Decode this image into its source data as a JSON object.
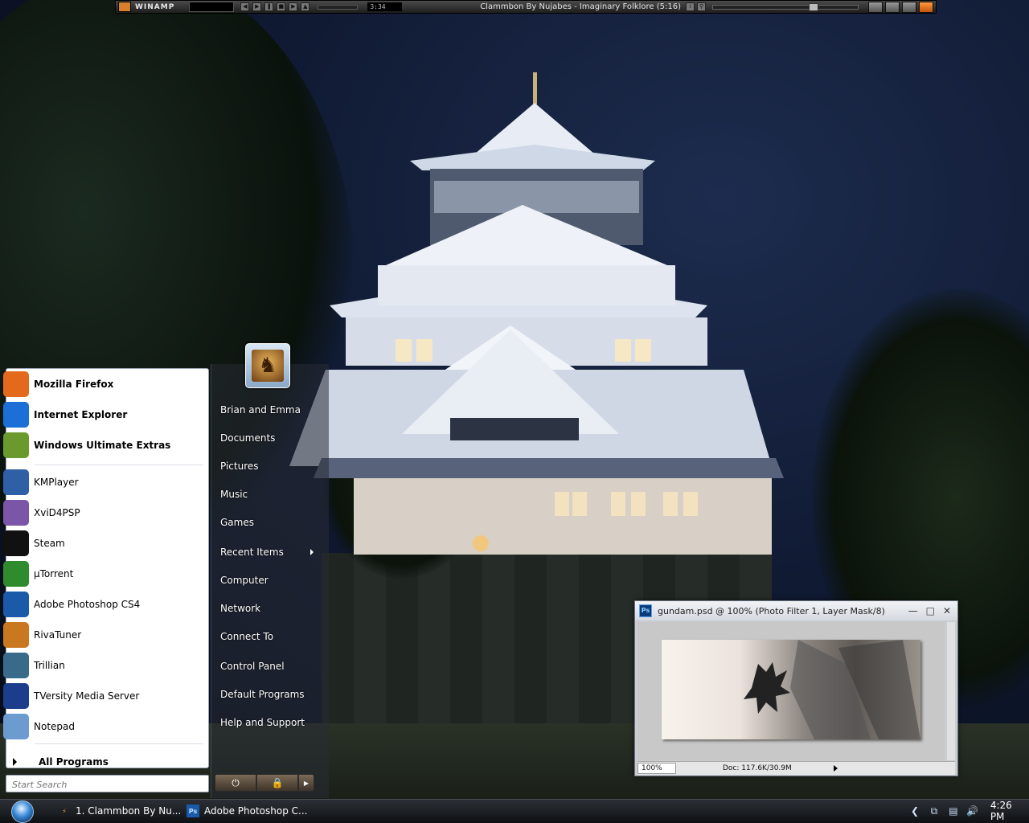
{
  "winamp": {
    "title": "WINAMP",
    "time": "3:34",
    "now_playing": "Clammbon By Nujabes - Imaginary Folklore (5:16)",
    "seek_fraction": 0.7
  },
  "start_menu": {
    "user_name": "Brian and Emma",
    "pinned": [
      {
        "label": "Mozilla Firefox",
        "icon": "firefox-icon",
        "color": "#e36a1c"
      },
      {
        "label": "Internet Explorer",
        "icon": "internet-explorer-icon",
        "color": "#1b6fd6"
      },
      {
        "label": "Windows Ultimate Extras",
        "icon": "ultimate-extras-icon",
        "color": "#6a9a2e"
      }
    ],
    "recent": [
      {
        "label": "KMPlayer",
        "icon": "kmplayer-icon",
        "color": "#2f5fa5"
      },
      {
        "label": "XviD4PSP",
        "icon": "xvid4psp-icon",
        "color": "#7a55a8"
      },
      {
        "label": "Steam",
        "icon": "steam-icon",
        "color": "#111111"
      },
      {
        "label": "µTorrent",
        "icon": "utorrent-icon",
        "color": "#2e8b2e"
      },
      {
        "label": "Adobe Photoshop CS4",
        "icon": "photoshop-icon",
        "color": "#1a5aa8"
      },
      {
        "label": "RivaTuner",
        "icon": "rivatuner-icon",
        "color": "#c9781f"
      },
      {
        "label": "Trillian",
        "icon": "trillian-icon",
        "color": "#3a6a8a"
      },
      {
        "label": "TVersity Media Server",
        "icon": "tversity-icon",
        "color": "#1c3d8c"
      },
      {
        "label": "Notepad",
        "icon": "notepad-icon",
        "color": "#6c9ccf"
      }
    ],
    "all_programs": "All Programs",
    "search_placeholder": "Start Search",
    "right_items": [
      "Brian and Emma",
      "Documents",
      "Pictures",
      "Music",
      "Games",
      "Recent Items",
      "Computer",
      "Network",
      "Connect To",
      "Control Panel",
      "Default Programs",
      "Help and Support"
    ]
  },
  "photoshop": {
    "title": "gundam.psd @ 100% (Photo Filter 1, Layer Mask/8)",
    "icon_text": "Ps",
    "zoom": "100%",
    "doc_info": "Doc: 117.6K/30.9M"
  },
  "taskbar": {
    "buttons": [
      {
        "label": "1. Clammbon By Nu...",
        "icon": "winamp-icon"
      },
      {
        "label": "Adobe Photoshop C...",
        "icon": "photoshop-icon"
      }
    ],
    "clock": "4:26 PM"
  }
}
